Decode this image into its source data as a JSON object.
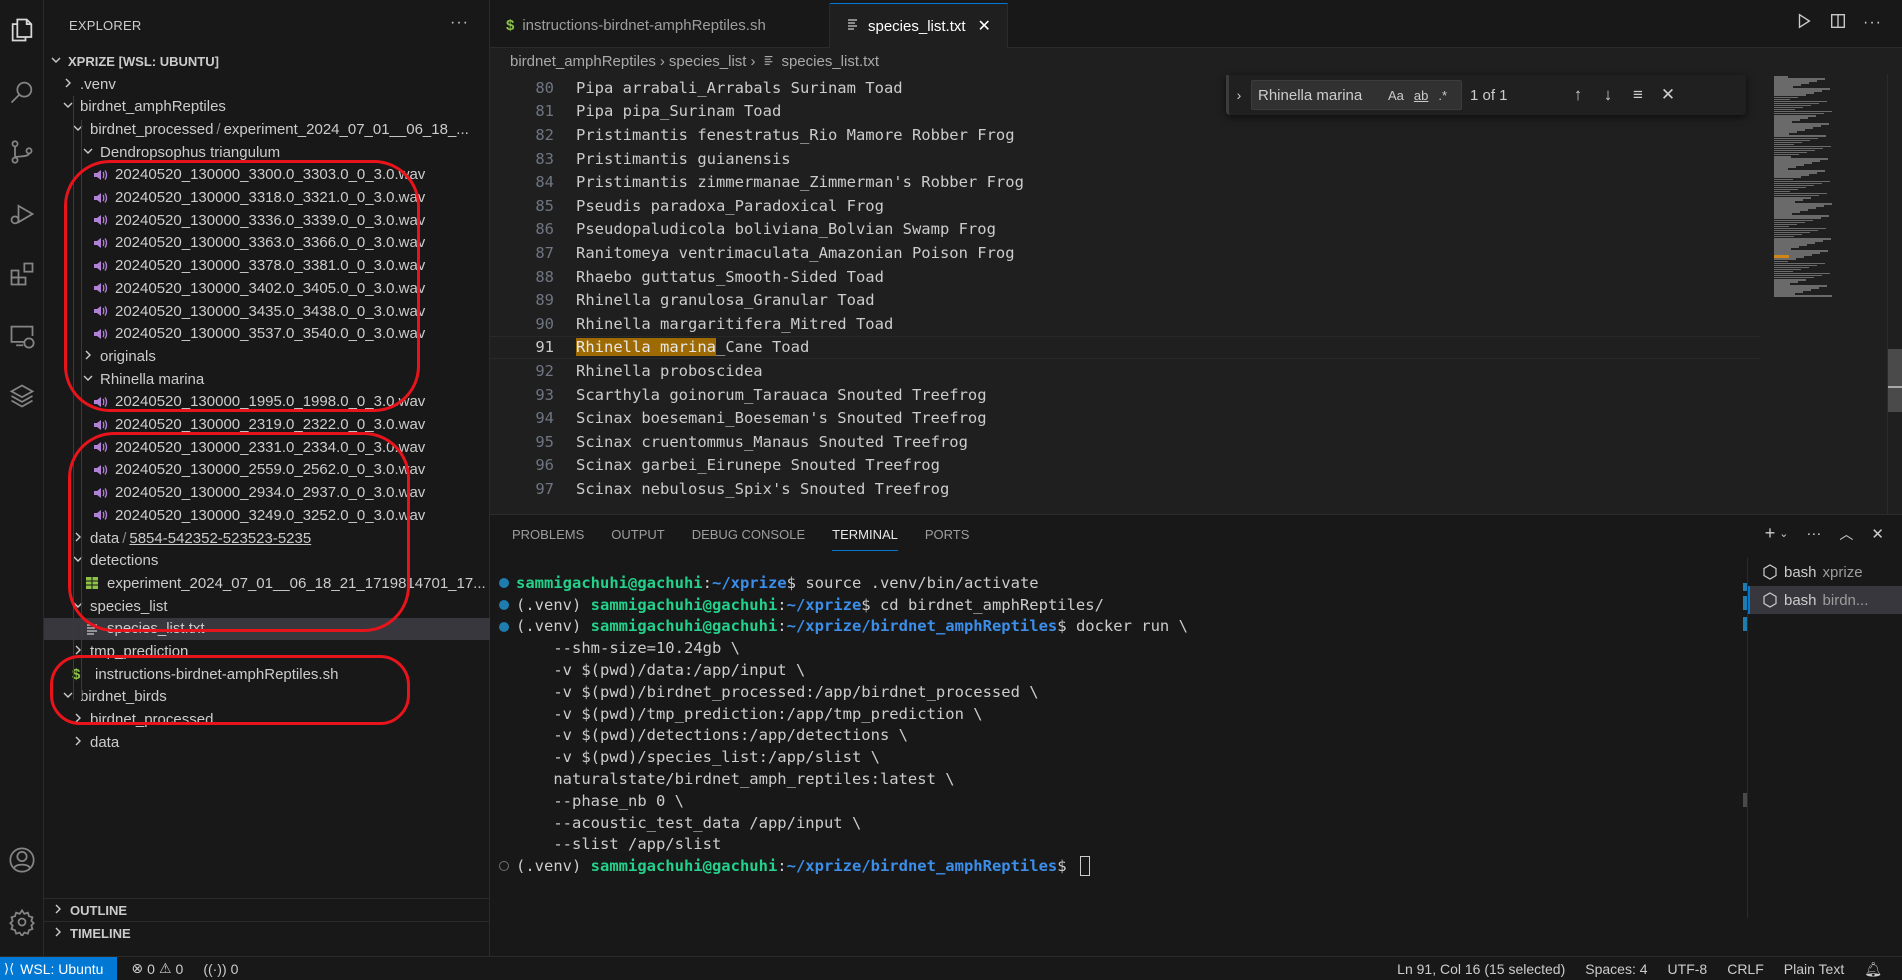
{
  "explorer": {
    "title": "EXPLORER",
    "more_label": "···",
    "workspace": "XPRIZE [WSL: UBUNTU]",
    "tree": [
      {
        "label": ".venv",
        "depth": 1,
        "expanded": false,
        "type": "folder"
      },
      {
        "label": "birdnet_amphReptiles",
        "depth": 1,
        "expanded": true,
        "type": "folder"
      },
      {
        "label": "birdnet_processed",
        "desc": "experiment_2024_07_01__06_18_...",
        "depth": 2,
        "expanded": true,
        "type": "folder"
      },
      {
        "label": "Dendropsophus triangulum",
        "depth": 3,
        "expanded": true,
        "type": "folder"
      },
      {
        "label": "20240520_130000_3300.0_3303.0_0_3.0.wav",
        "depth": 4,
        "type": "wav"
      },
      {
        "label": "20240520_130000_3318.0_3321.0_0_3.0.wav",
        "depth": 4,
        "type": "wav"
      },
      {
        "label": "20240520_130000_3336.0_3339.0_0_3.0.wav",
        "depth": 4,
        "type": "wav"
      },
      {
        "label": "20240520_130000_3363.0_3366.0_0_3.0.wav",
        "depth": 4,
        "type": "wav"
      },
      {
        "label": "20240520_130000_3378.0_3381.0_0_3.0.wav",
        "depth": 4,
        "type": "wav"
      },
      {
        "label": "20240520_130000_3402.0_3405.0_0_3.0.wav",
        "depth": 4,
        "type": "wav"
      },
      {
        "label": "20240520_130000_3435.0_3438.0_0_3.0.wav",
        "depth": 4,
        "type": "wav"
      },
      {
        "label": "20240520_130000_3537.0_3540.0_0_3.0.wav",
        "depth": 4,
        "type": "wav"
      },
      {
        "label": "originals",
        "depth": 3,
        "expanded": false,
        "type": "folder"
      },
      {
        "label": "Rhinella marina",
        "depth": 3,
        "expanded": true,
        "type": "folder"
      },
      {
        "label": "20240520_130000_1995.0_1998.0_0_3.0.wav",
        "depth": 4,
        "type": "wav"
      },
      {
        "label": "20240520_130000_2319.0_2322.0_0_3.0.wav",
        "depth": 4,
        "type": "wav"
      },
      {
        "label": "20240520_130000_2331.0_2334.0_0_3.0.wav",
        "depth": 4,
        "type": "wav"
      },
      {
        "label": "20240520_130000_2559.0_2562.0_0_3.0.wav",
        "depth": 4,
        "type": "wav"
      },
      {
        "label": "20240520_130000_2934.0_2937.0_0_3.0.wav",
        "depth": 4,
        "type": "wav"
      },
      {
        "label": "20240520_130000_3249.0_3252.0_0_3.0.wav",
        "depth": 4,
        "type": "wav"
      },
      {
        "label": "data",
        "desc": "5854-542352-523523-5235",
        "depth": 2,
        "expanded": false,
        "type": "folder"
      },
      {
        "label": "detections",
        "depth": 2,
        "expanded": true,
        "type": "folder"
      },
      {
        "label": "experiment_2024_07_01__06_18_21_1719814701_17...",
        "depth": 3,
        "type": "csv"
      },
      {
        "label": "species_list",
        "depth": 2,
        "expanded": true,
        "type": "folder"
      },
      {
        "label": "species_list.txt",
        "depth": 3,
        "type": "txt",
        "selected": true
      },
      {
        "label": "tmp_prediction",
        "depth": 2,
        "expanded": false,
        "type": "folder"
      },
      {
        "label": "instructions-birdnet-amphReptiles.sh",
        "depth": 2,
        "type": "sh"
      },
      {
        "label": "birdnet_birds",
        "depth": 1,
        "expanded": true,
        "type": "folder"
      },
      {
        "label": "birdnet_processed",
        "depth": 2,
        "expanded": false,
        "type": "folder"
      },
      {
        "label": "data",
        "depth": 2,
        "expanded": false,
        "type": "folder"
      }
    ],
    "sections": [
      "OUTLINE",
      "TIMELINE"
    ]
  },
  "tabs": [
    {
      "label": "instructions-birdnet-amphReptiles.sh",
      "icon": "dollar",
      "active": false
    },
    {
      "label": "species_list.txt",
      "icon": "lines",
      "active": true
    }
  ],
  "tab_actions": {
    "more": "···"
  },
  "breadcrumb": [
    "birdnet_amphReptiles",
    "species_list",
    "species_list.txt"
  ],
  "editor": {
    "lines": [
      {
        "n": "80",
        "text": "Pipa arrabali_Arrabals Surinam Toad"
      },
      {
        "n": "81",
        "text": "Pipa pipa_Surinam Toad"
      },
      {
        "n": "82",
        "text": "Pristimantis fenestratus_Rio Mamore Robber Frog"
      },
      {
        "n": "83",
        "text": "Pristimantis guianensis"
      },
      {
        "n": "84",
        "text": "Pristimantis zimmermanae_Zimmerman's Robber Frog"
      },
      {
        "n": "85",
        "text": "Pseudis paradoxa_Paradoxical Frog"
      },
      {
        "n": "86",
        "text": "Pseudopaludicola boliviana_Bolvian Swamp Frog"
      },
      {
        "n": "87",
        "text": "Ranitomeya ventrimaculata_Amazonian Poison Frog"
      },
      {
        "n": "88",
        "text": "Rhaebo guttatus_Smooth-Sided Toad"
      },
      {
        "n": "89",
        "text": "Rhinella granulosa_Granular Toad"
      },
      {
        "n": "90",
        "text": "Rhinella margaritifera_Mitred Toad"
      },
      {
        "n": "91",
        "text": "_Cane Toad",
        "highlight": "Rhinella marina",
        "current": true
      },
      {
        "n": "92",
        "text": "Rhinella proboscidea"
      },
      {
        "n": "93",
        "text": "Scarthyla goinorum_Tarauaca Snouted Treefrog"
      },
      {
        "n": "94",
        "text": "Scinax boesemani_Boeseman's Snouted Treefrog"
      },
      {
        "n": "95",
        "text": "Scinax cruentommus_Manaus Snouted Treefrog"
      },
      {
        "n": "96",
        "text": "Scinax garbei_Eirunepe Snouted Treefrog"
      },
      {
        "n": "97",
        "text": "Scinax nebulosus_Spix's Snouted Treefrog"
      }
    ]
  },
  "find": {
    "value": "Rhinella marina",
    "match_case": "Aa",
    "whole_word": "ab",
    "regex": ".*",
    "count": "1 of 1"
  },
  "panel": {
    "tabs": [
      "PROBLEMS",
      "OUTPUT",
      "DEBUG CONSOLE",
      "TERMINAL",
      "PORTS"
    ],
    "active_tab": "TERMINAL",
    "more": "···",
    "terminal": [
      {
        "dot": "filled",
        "venv": "",
        "user": "sammigachuhi@gachuhi",
        "path": "~/xprize",
        "cmd": "source .venv/bin/activate"
      },
      {
        "dot": "filled",
        "venv": "(.venv) ",
        "user": "sammigachuhi@gachuhi",
        "path": "~/xprize",
        "cmd": "cd birdnet_amphReptiles/"
      },
      {
        "dot": "filled",
        "venv": "(.venv) ",
        "user": "sammigachuhi@gachuhi",
        "path": "~/xprize/birdnet_amphReptiles",
        "cmd": "docker run \\"
      },
      {
        "text": "    --shm-size=10.24gb \\"
      },
      {
        "text": "    -v $(pwd)/data:/app/input \\"
      },
      {
        "text": "    -v $(pwd)/birdnet_processed:/app/birdnet_processed \\"
      },
      {
        "text": "    -v $(pwd)/tmp_prediction:/app/tmp_prediction \\"
      },
      {
        "text": "    -v $(pwd)/detections:/app/detections \\"
      },
      {
        "text": "    -v $(pwd)/species_list:/app/slist \\"
      },
      {
        "text": "    naturalstate/birdnet_amph_reptiles:latest \\"
      },
      {
        "text": "    --phase_nb 0 \\"
      },
      {
        "text": "    --acoustic_test_data /app/input \\"
      },
      {
        "text": "    --slist /app/slist"
      },
      {
        "dot": "hollow",
        "venv": "(.venv) ",
        "user": "sammigachuhi@gachuhi",
        "path": "~/xprize/birdnet_amphReptiles",
        "cmd": "",
        "cursor": true
      }
    ],
    "terminals": [
      {
        "name": "bash",
        "desc": "xprize",
        "active": false
      },
      {
        "name": "bash",
        "desc": "birdn...",
        "active": true
      }
    ]
  },
  "statusbar": {
    "remote": "WSL: Ubuntu",
    "errors": "0",
    "warnings": "0",
    "ports": "0",
    "position": "Ln 91, Col 16 (15 selected)",
    "spaces": "Spaces: 4",
    "encoding": "UTF-8",
    "eol": "CRLF",
    "language": "Plain Text"
  },
  "colors": {
    "accent": "#0078d4",
    "find_highlight": "#9e6a03",
    "annotation": "#e8141c",
    "terminal_user": "#23d18b",
    "terminal_path": "#3b8eea",
    "wav_icon": "#b180d7",
    "csv_icon": "#8dc149"
  }
}
